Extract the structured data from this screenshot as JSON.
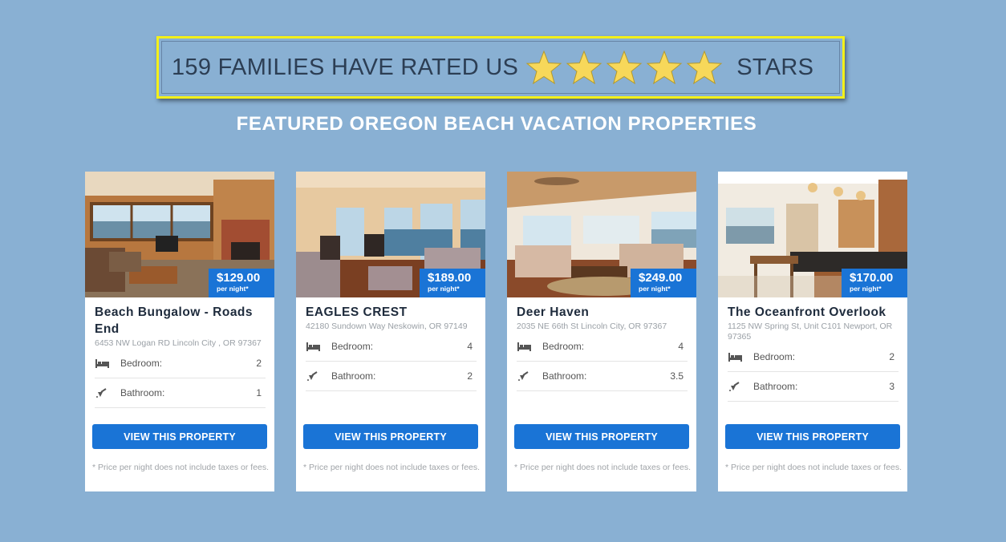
{
  "rating": {
    "text_before": "159 FAMILIES HAVE RATED US",
    "star_count": 5,
    "text_after": "STARS",
    "star_color": "#f7d85a",
    "border_color": "#f3f01a"
  },
  "subtitle": "FEATURED OREGON BEACH VACATION PROPERTIES",
  "colors": {
    "background": "#89b0d3",
    "accent": "#1a74d6"
  },
  "properties": [
    {
      "title": "Beach Bungalow - Roads End",
      "address": "6453 NW Logan RD Lincoln City , OR 97367",
      "price": "$129.00",
      "price_unit": "per night*",
      "bedroom_label": "Bedroom:",
      "bedroom_value": "2",
      "bathroom_label": "Bathroom:",
      "bathroom_value": "1",
      "button_label": "VIEW THIS PROPERTY",
      "disclaimer": "* Price per night does not include taxes or fees."
    },
    {
      "title": "EAGLES CREST",
      "address": "42180 Sundown Way Neskowin, OR 97149",
      "price": "$189.00",
      "price_unit": "per night*",
      "bedroom_label": "Bedroom:",
      "bedroom_value": "4",
      "bathroom_label": "Bathroom:",
      "bathroom_value": "2",
      "button_label": "VIEW THIS PROPERTY",
      "disclaimer": "* Price per night does not include taxes or fees."
    },
    {
      "title": "Deer Haven",
      "address": "2035 NE 66th St Lincoln City, OR 97367",
      "price": "$249.00",
      "price_unit": "per night*",
      "bedroom_label": "Bedroom:",
      "bedroom_value": "4",
      "bathroom_label": "Bathroom:",
      "bathroom_value": "3.5",
      "button_label": "VIEW THIS PROPERTY",
      "disclaimer": "* Price per night does not include taxes or fees."
    },
    {
      "title": "The Oceanfront Overlook",
      "address": "1125 NW Spring St, Unit C101 Newport, OR 97365",
      "price": "$170.00",
      "price_unit": "per night*",
      "bedroom_label": "Bedroom:",
      "bedroom_value": "2",
      "bathroom_label": "Bathroom:",
      "bathroom_value": "3",
      "button_label": "VIEW THIS PROPERTY",
      "disclaimer": "* Price per night does not include taxes or fees."
    }
  ]
}
